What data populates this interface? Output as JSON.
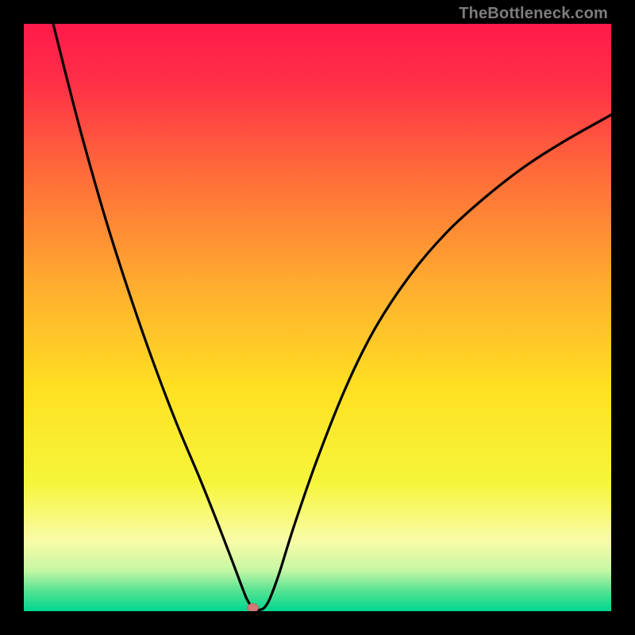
{
  "watermark": "TheBottleneck.com",
  "chart_data": {
    "type": "line",
    "title": "",
    "xlabel": "",
    "ylabel": "",
    "xlim": [
      0,
      100
    ],
    "ylim": [
      0,
      100
    ],
    "background_gradient": {
      "stops": [
        {
          "offset": 0.0,
          "color": "#ff1a4b"
        },
        {
          "offset": 0.1,
          "color": "#ff2f47"
        },
        {
          "offset": 0.25,
          "color": "#ff6a3a"
        },
        {
          "offset": 0.45,
          "color": "#ffae2f"
        },
        {
          "offset": 0.62,
          "color": "#ffe022"
        },
        {
          "offset": 0.78,
          "color": "#f6f53a"
        },
        {
          "offset": 0.88,
          "color": "#f9fca8"
        },
        {
          "offset": 0.93,
          "color": "#c7f7a4"
        },
        {
          "offset": 0.965,
          "color": "#57e393"
        },
        {
          "offset": 1.0,
          "color": "#00d68f"
        }
      ]
    },
    "curve": {
      "color": "#000000",
      "width": 3.2,
      "points": [
        {
          "x": 5.0,
          "y": 100.0
        },
        {
          "x": 7.0,
          "y": 92.0
        },
        {
          "x": 10.0,
          "y": 80.5
        },
        {
          "x": 14.0,
          "y": 66.5
        },
        {
          "x": 18.0,
          "y": 54.0
        },
        {
          "x": 22.0,
          "y": 42.5
        },
        {
          "x": 26.0,
          "y": 32.0
        },
        {
          "x": 30.0,
          "y": 22.5
        },
        {
          "x": 33.0,
          "y": 15.0
        },
        {
          "x": 35.5,
          "y": 8.5
        },
        {
          "x": 37.0,
          "y": 4.5
        },
        {
          "x": 38.0,
          "y": 2.0
        },
        {
          "x": 38.8,
          "y": 0.8
        },
        {
          "x": 39.5,
          "y": 0.3
        },
        {
          "x": 40.5,
          "y": 0.3
        },
        {
          "x": 41.2,
          "y": 0.9
        },
        {
          "x": 42.0,
          "y": 2.4
        },
        {
          "x": 43.5,
          "y": 6.5
        },
        {
          "x": 46.0,
          "y": 14.5
        },
        {
          "x": 50.0,
          "y": 26.0
        },
        {
          "x": 55.0,
          "y": 38.5
        },
        {
          "x": 60.0,
          "y": 48.5
        },
        {
          "x": 66.0,
          "y": 57.5
        },
        {
          "x": 72.0,
          "y": 64.5
        },
        {
          "x": 78.0,
          "y": 70.0
        },
        {
          "x": 85.0,
          "y": 75.5
        },
        {
          "x": 92.0,
          "y": 80.0
        },
        {
          "x": 100.0,
          "y": 84.5
        }
      ]
    },
    "marker": {
      "x": 39.0,
      "y": 0.6,
      "rx": 7,
      "ry": 5,
      "fill": "#cf7a77",
      "stroke": "#b96763"
    }
  }
}
